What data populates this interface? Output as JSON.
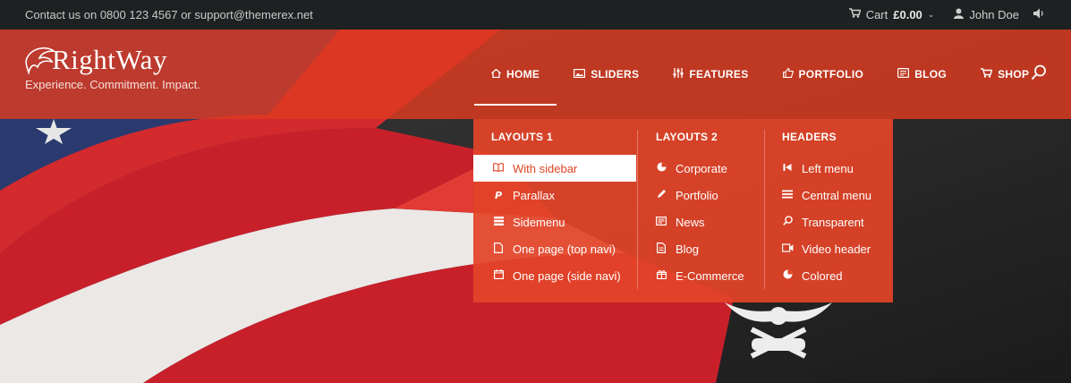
{
  "topbar": {
    "contact": "Contact us on 0800 123 4567 or support@themerex.net",
    "cart_label": "Cart",
    "cart_amount": "£0.00",
    "user_name": "John Doe"
  },
  "brand": {
    "name": "RightWay",
    "tagline": "Experience. Commitment. Impact."
  },
  "nav": {
    "items": [
      {
        "label": "HOME",
        "icon": "home-icon"
      },
      {
        "label": "SLIDERS",
        "icon": "image-icon"
      },
      {
        "label": "FEATURES",
        "icon": "sliders-icon"
      },
      {
        "label": "PORTFOLIO",
        "icon": "thumbs-up-icon"
      },
      {
        "label": "BLOG",
        "icon": "book-icon"
      },
      {
        "label": "SHOP",
        "icon": "cart-icon"
      }
    ]
  },
  "dropdown": {
    "columns": [
      {
        "heading": "LAYOUTS 1",
        "items": [
          {
            "label": "With sidebar",
            "icon": "book-open-icon"
          },
          {
            "label": "Parallax",
            "icon": "paypal-icon"
          },
          {
            "label": "Sidemenu",
            "icon": "list-icon"
          },
          {
            "label": "One page (top navi)",
            "icon": "document-icon"
          },
          {
            "label": "One page (side navi)",
            "icon": "calendar-icon"
          }
        ]
      },
      {
        "heading": "LAYOUTS 2",
        "items": [
          {
            "label": "Corporate",
            "icon": "pie-chart-icon"
          },
          {
            "label": "Portfolio",
            "icon": "pencil-icon"
          },
          {
            "label": "News",
            "icon": "newspaper-icon"
          },
          {
            "label": "Blog",
            "icon": "document-icon"
          },
          {
            "label": "E-Commerce",
            "icon": "gift-icon"
          }
        ]
      },
      {
        "heading": "HEADERS",
        "items": [
          {
            "label": "Left menu",
            "icon": "skip-back-icon"
          },
          {
            "label": "Central menu",
            "icon": "menu-icon"
          },
          {
            "label": "Transparent",
            "icon": "search-icon"
          },
          {
            "label": "Video header",
            "icon": "video-icon"
          },
          {
            "label": "Colored",
            "icon": "pie-chart-icon"
          }
        ]
      }
    ]
  },
  "colors": {
    "accent": "#e14425",
    "topbar_bg": "#1e2122",
    "header_bg": "#de3a20"
  }
}
